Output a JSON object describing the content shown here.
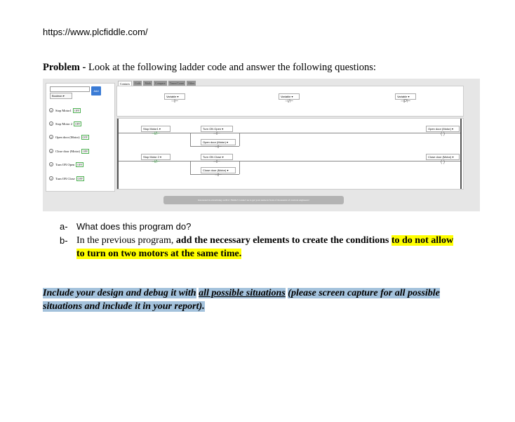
{
  "url": "https://www.plcfiddle.com/",
  "problem": {
    "label": "Problem -",
    "text": "Look at the following ladder code and answer the following questions:"
  },
  "screenshot": {
    "add_label": "Add",
    "type_select": "Boolean",
    "variables": [
      {
        "name": "Stop Motor1",
        "state": "OFF"
      },
      {
        "name": "Stop Motor 2",
        "state": "OFF"
      },
      {
        "name": "Open door (Motor)",
        "state": "OFF"
      },
      {
        "name": "Close door (Motor)",
        "state": "OFF"
      },
      {
        "name": "Turn ON Open",
        "state": "OFF"
      },
      {
        "name": "Turn ON Close",
        "state": "OFF"
      }
    ],
    "tabs": [
      "Contacts",
      "Coils",
      "Math",
      "Compare",
      "Timer/Count",
      "Other"
    ],
    "toolbox": [
      {
        "label": "Variable",
        "symbol": "⊣⊢"
      },
      {
        "label": "Variable",
        "symbol": "⊣/⊢"
      },
      {
        "label": "Variable",
        "symbol": "⊣P⊢"
      }
    ],
    "rung1": {
      "contact": "Stop Motor1",
      "branch_a": "Turn ON Open",
      "branch_b": "Open door (Motor)",
      "coil": "Open door (Motor)"
    },
    "rung2": {
      "contact": "Stop Motor 2",
      "branch_a": "Turn ON Close",
      "branch_b": "Close door (Motor)",
      "coil": "Close door (Motor)"
    },
    "footer": "Interested in advertising on PLC Fiddle? Contact us to get your name in front of thousands of controls engineers!"
  },
  "questions": [
    {
      "marker": "a-",
      "text": "What does this program do?"
    },
    {
      "marker": "b-",
      "text_pre": "In the previous program,",
      "text_bold": "add the necessary elements to create the conditions",
      "text_hl_1": "to do not allow",
      "text_hl_2": "to turn on two motors at the same time."
    }
  ],
  "include": {
    "line1_a": "Include your design and debug it with",
    "line1_b": "all possible situations",
    "line1_c": "(please screen capture for all possible",
    "line2": "situations and include it in your report)."
  }
}
